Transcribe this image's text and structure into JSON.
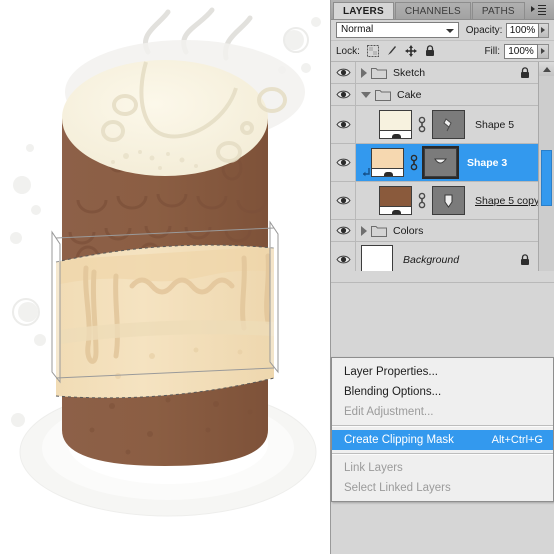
{
  "app": {
    "panel_title": "LAYERS"
  },
  "panel": {
    "tabs": [
      {
        "label": "LAYERS",
        "active": true
      },
      {
        "label": "CHANNELS",
        "active": false
      },
      {
        "label": "PATHS",
        "active": false
      }
    ],
    "menu_icon": "panel-menu-icon",
    "blend": {
      "mode": "Normal",
      "opacity_label": "Opacity:",
      "opacity_value": "100%"
    },
    "lock": {
      "label": "Lock:",
      "icons": [
        "lock-transparency-icon",
        "lock-image-pixels-icon",
        "lock-position-icon",
        "lock-all-icon"
      ],
      "fill_label": "Fill:",
      "fill_value": "100%"
    },
    "layers": [
      {
        "name": "Sketch",
        "type": "group",
        "visible": true,
        "expanded": false,
        "locked": true,
        "selected": false
      },
      {
        "name": "Cake",
        "type": "group",
        "visible": true,
        "expanded": true,
        "locked": false,
        "selected": false
      },
      {
        "name": "Shape 5",
        "type": "shape",
        "visible": true,
        "selected": false,
        "thumb_color": "#f7f2df",
        "mask_active": false,
        "clipped": false,
        "name_style": "normal"
      },
      {
        "name": "Shape 3",
        "type": "shape",
        "visible": true,
        "selected": true,
        "thumb_color": "#f6d8b0",
        "mask_active": true,
        "clipped": true,
        "name_style": "normal"
      },
      {
        "name": "Shape 5 copy",
        "type": "shape",
        "visible": true,
        "selected": false,
        "thumb_color": "#8a5a3c",
        "mask_active": false,
        "clipped": false,
        "name_style": "underline"
      },
      {
        "name": "Colors",
        "type": "group",
        "visible": true,
        "expanded": false,
        "locked": false,
        "selected": false
      },
      {
        "name": "Background",
        "type": "background",
        "visible": true,
        "locked": true,
        "selected": false,
        "thumb_color": "#ffffff",
        "name_style": "italic"
      }
    ],
    "scrollbar": {
      "up_arrow": "scroll-up-arrow-icon",
      "thumb_color": "#3399ee"
    }
  },
  "context_menu": {
    "items": [
      {
        "label": "Layer Properties...",
        "shortcut": "",
        "enabled": true,
        "highlighted": false,
        "separator_after": false
      },
      {
        "label": "Blending Options...",
        "shortcut": "",
        "enabled": true,
        "highlighted": false,
        "separator_after": false
      },
      {
        "label": "Edit Adjustment...",
        "shortcut": "",
        "enabled": false,
        "highlighted": false,
        "separator_after": true
      },
      {
        "label": "Create Clipping Mask",
        "shortcut": "Alt+Ctrl+G",
        "enabled": true,
        "highlighted": true,
        "separator_after": true
      },
      {
        "label": "Link Layers",
        "shortcut": "",
        "enabled": false,
        "highlighted": false,
        "separator_after": false
      },
      {
        "label": "Select Linked Layers",
        "shortcut": "",
        "enabled": false,
        "highlighted": false,
        "separator_after": false
      }
    ]
  },
  "canvas": {
    "description": "coffee-cake-illustration",
    "colors": {
      "cream_top": "#faf5e2",
      "cake_brown": "#8b5e43",
      "cake_brown_dark": "#7d513a",
      "caramel_band": "#f2deb8",
      "caramel_band_light": "#f7e8cc",
      "drip": "#e3c79c",
      "background": "#ffffff",
      "steam": "#d8d6d2",
      "plate": "#f4f4f2",
      "selection_outline": "#8d8d8d"
    }
  },
  "colors": {
    "accent_blue": "#3399ee",
    "panel_grey": "#d6d6d6",
    "menu_grey": "#efefef"
  }
}
